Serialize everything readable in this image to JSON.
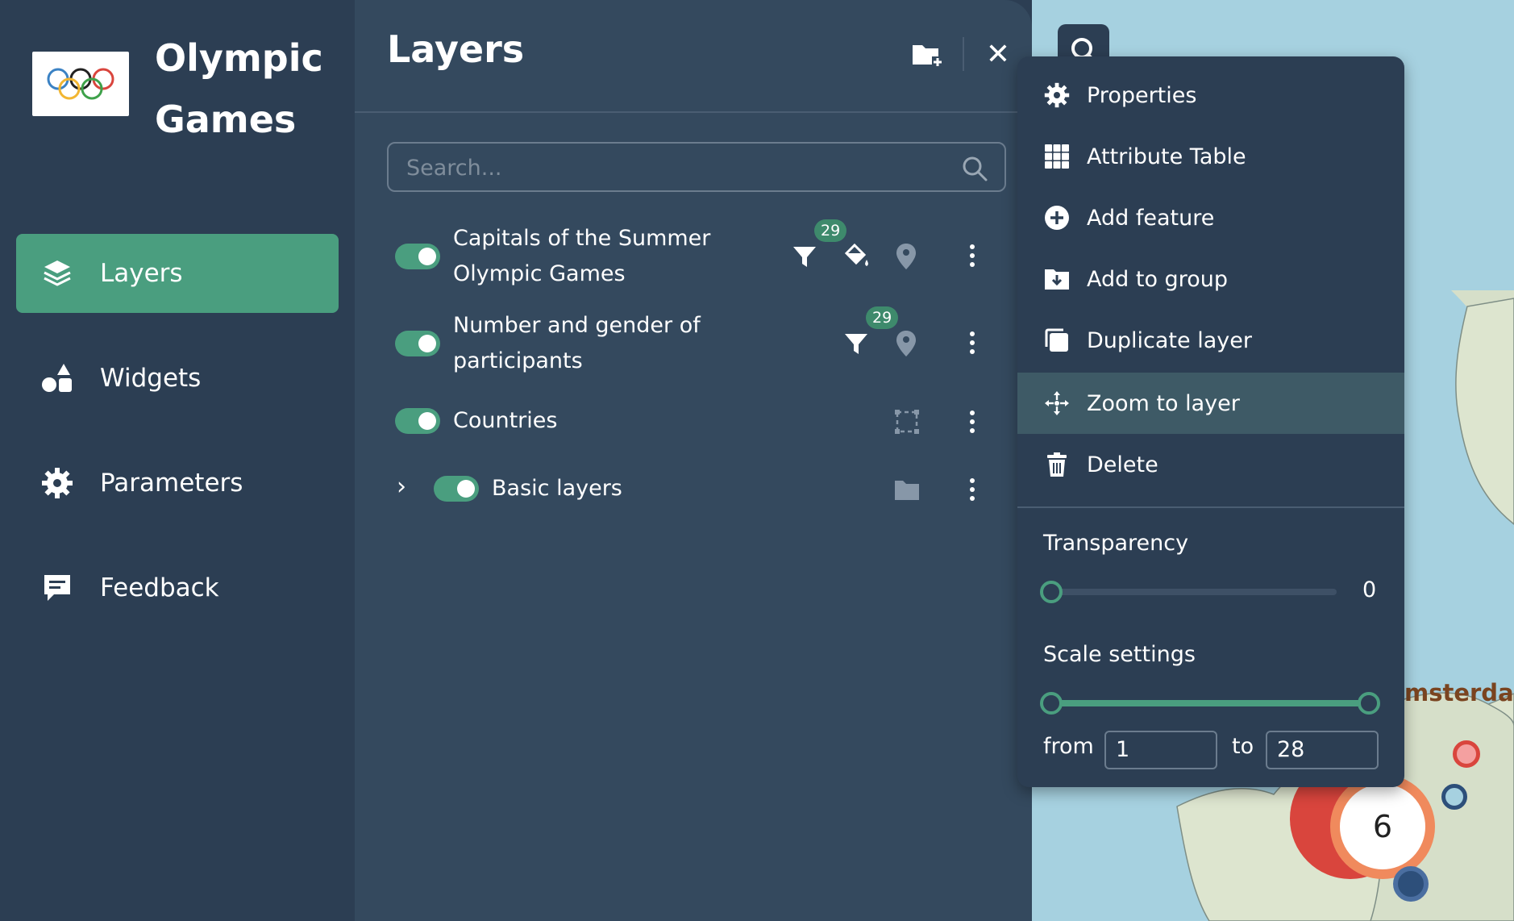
{
  "app": {
    "title_line1": "Olympic",
    "title_line2": "Games"
  },
  "sidebar": {
    "items": [
      {
        "label": "Layers",
        "icon": "layers-icon",
        "active": true
      },
      {
        "label": "Widgets",
        "icon": "widgets-icon",
        "active": false
      },
      {
        "label": "Parameters",
        "icon": "gear-icon",
        "active": false
      },
      {
        "label": "Feedback",
        "icon": "feedback-icon",
        "active": false
      }
    ]
  },
  "layers_panel": {
    "title": "Layers",
    "search_placeholder": "Search...",
    "layers": [
      {
        "name_line1": "Capitals of the Summer",
        "name_line2": "Olympic Games",
        "filter_count": "29",
        "enabled": true
      },
      {
        "name_line1": "Number and gender of",
        "name_line2": "participants",
        "filter_count": "29",
        "enabled": true
      },
      {
        "name_line1": "Countries",
        "enabled": true
      },
      {
        "name_line1": "Basic layers",
        "enabled": true,
        "collapsed": true
      }
    ]
  },
  "context_menu": {
    "items": [
      {
        "label": "Properties",
        "icon": "gear-icon"
      },
      {
        "label": "Attribute Table",
        "icon": "table-icon"
      },
      {
        "label": "Add feature",
        "icon": "plus-circle-icon"
      },
      {
        "label": "Add to group",
        "icon": "folder-download-icon"
      },
      {
        "label": "Duplicate layer",
        "icon": "duplicate-icon"
      },
      {
        "label": "Zoom to layer",
        "icon": "zoom-arrows-icon",
        "active": true
      },
      {
        "label": "Delete",
        "icon": "trash-icon"
      }
    ],
    "transparency": {
      "label": "Transparency",
      "value": "0"
    },
    "scale": {
      "label": "Scale settings",
      "from_label": "from",
      "from_value": "1",
      "to_label": "to",
      "to_value": "28"
    }
  },
  "map": {
    "city_label": "msterdan",
    "cluster_count": "6"
  },
  "colors": {
    "sidebar_bg": "#2c3e53",
    "panel_bg": "#34495e",
    "accent": "#4a9e7f"
  }
}
